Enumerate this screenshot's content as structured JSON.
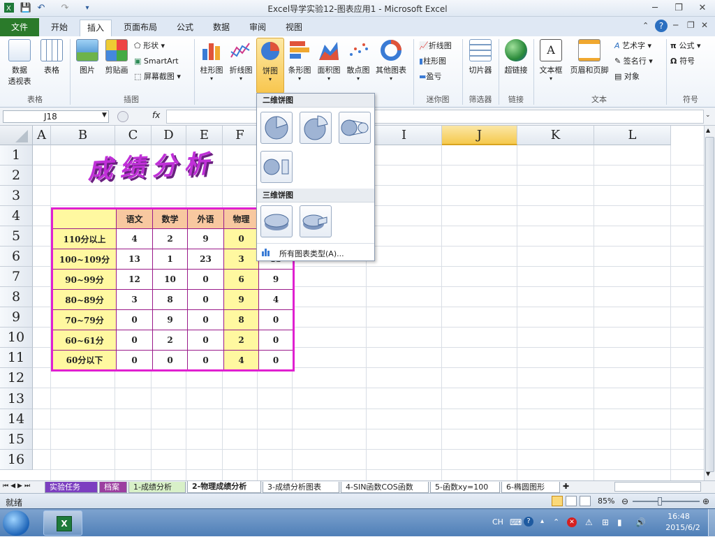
{
  "window": {
    "title": "Excel导学实验12-图表应用1 - Microsoft Excel"
  },
  "tabs": [
    "文件",
    "开始",
    "插入",
    "页面布局",
    "公式",
    "数据",
    "审阅",
    "视图"
  ],
  "active_tab": "插入",
  "ribbon": {
    "groups": {
      "table": "表格",
      "illustrations": "插图",
      "charts_launcher": "",
      "sparklines": "迷你图",
      "filter": "筛选器",
      "links": "链接",
      "text": "文本",
      "symbols": "符号"
    },
    "buttons": {
      "pivot_l1": "数据",
      "pivot_l2": "透视表",
      "table": "表格",
      "picture": "图片",
      "clipart": "剪贴画",
      "shapes": "形状",
      "smartart": "SmartArt",
      "screenshot": "屏幕截图",
      "column": "柱形图",
      "line": "折线图",
      "pie": "饼图",
      "bar": "条形图",
      "area": "面积图",
      "scatter": "散点图",
      "other": "其他图表",
      "spark_line": "折线图",
      "spark_column": "柱形图",
      "spark_winloss": "盈亏",
      "slicer": "切片器",
      "hyperlink": "超链接",
      "textbox": "文本框",
      "header_footer": "页眉和页脚",
      "wordart": "艺术字",
      "signature": "签名行",
      "object": "对象",
      "equation": "公式",
      "symbol": "符号"
    }
  },
  "formula_bar": {
    "name_box": "J18",
    "fx": "fx",
    "value": ""
  },
  "grid": {
    "columns": [
      "A",
      "B",
      "C",
      "D",
      "E",
      "F",
      "G",
      "H",
      "I",
      "J",
      "K",
      "L"
    ],
    "selected_column": "J",
    "rows": [
      "1",
      "2",
      "3",
      "4",
      "5",
      "6",
      "7",
      "8",
      "9",
      "10",
      "11",
      "12",
      "13",
      "14",
      "15",
      "16"
    ],
    "title_art": "成绩分析",
    "table_header": [
      "",
      "语文",
      "数学",
      "外语",
      "物理",
      ""
    ],
    "table_rows": [
      [
        "110分以上",
        "4",
        "2",
        "9",
        "0",
        ""
      ],
      [
        "100~109分",
        "13",
        "1",
        "23",
        "3",
        "13"
      ],
      [
        "90~99分",
        "12",
        "10",
        "0",
        "6",
        "9"
      ],
      [
        "80~89分",
        "3",
        "8",
        "0",
        "9",
        "4"
      ],
      [
        "70~79分",
        "0",
        "9",
        "0",
        "8",
        "0"
      ],
      [
        "60~61分",
        "0",
        "2",
        "0",
        "2",
        "0"
      ],
      [
        "60分以下",
        "0",
        "0",
        "0",
        "4",
        "0"
      ]
    ]
  },
  "dropdown": {
    "section_2d": "二维饼图",
    "section_3d": "三维饼图",
    "all_types": "所有图表类型(A)..."
  },
  "sheet_tabs": [
    "实验任务",
    "档案",
    "1-成绩分析",
    "2-物理成绩分析",
    "3-成绩分析图表",
    "4-SIN函数COS函数",
    "5-函数xy=100",
    "6-椭圆图形"
  ],
  "active_sheet": "2-物理成绩分析",
  "status": {
    "ready": "就绪",
    "zoom": "85%"
  },
  "taskbar": {
    "lang": "CH",
    "time": "16:48",
    "date": "2015/6/2"
  },
  "colors": {
    "accent": "#e020d0",
    "header_fill": "#f8c8a0",
    "highlight": "#fff8a0",
    "file_tab": "#2a7a2a"
  }
}
